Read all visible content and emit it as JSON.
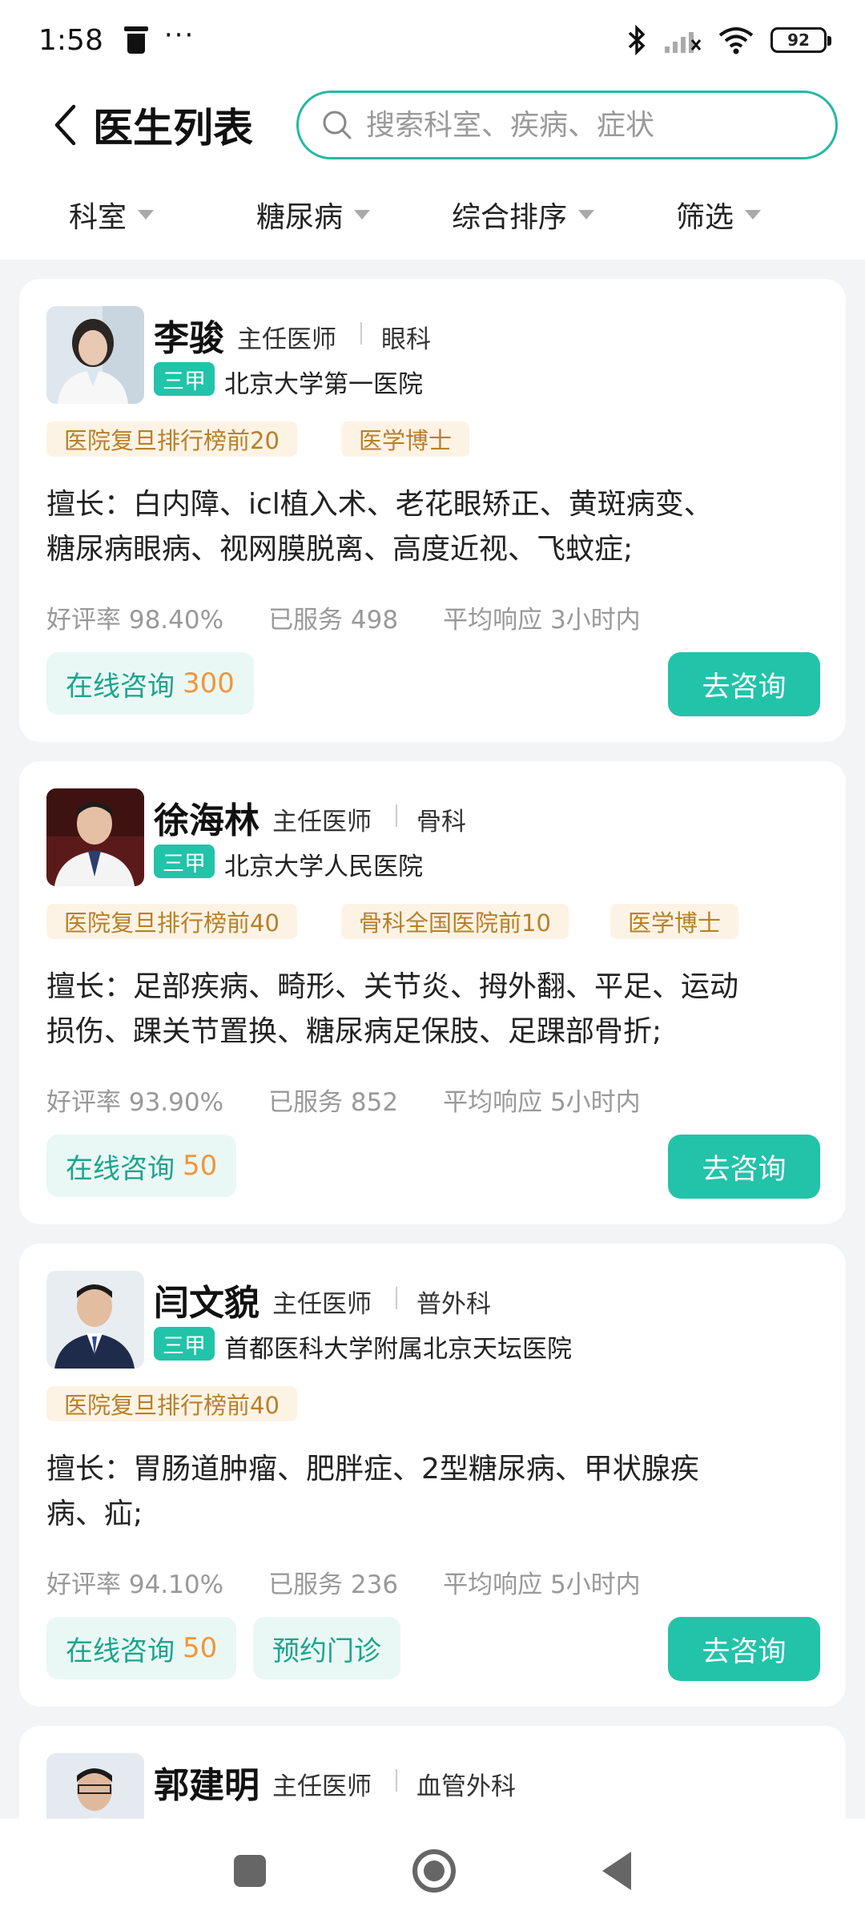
{
  "status_bar": {
    "time": "1:58",
    "battery": "92"
  },
  "header": {
    "title": "医生列表",
    "search_placeholder": "搜索科室、疾病、症状"
  },
  "filters": [
    "科室",
    "糖尿病",
    "综合排序",
    "筛选"
  ],
  "doctors": [
    {
      "name": "李骏",
      "title": "主任医师",
      "department": "眼科",
      "grade": "三甲",
      "hospital": "北京大学第一医院",
      "tags": [
        "医院复旦排行榜前20",
        "医学博士"
      ],
      "specialty_line1": "擅长：白内障、icl植入术、老花眼矫正、黄斑病变、",
      "specialty_line2": "糖尿病眼病、视网膜脱离、高度近视、飞蚊症;",
      "rating": "好评率 98.40%",
      "served": "已服务 498",
      "response": "平均响应 3小时内",
      "consult_label": "在线咨询",
      "consult_price": "300",
      "action": "去咨询"
    },
    {
      "name": "徐海林",
      "title": "主任医师",
      "department": "骨科",
      "grade": "三甲",
      "hospital": "北京大学人民医院",
      "tags": [
        "医院复旦排行榜前40",
        "骨科全国医院前10",
        "医学博士"
      ],
      "specialty_line1": "擅长：足部疾病、畸形、关节炎、拇外翻、平足、运动",
      "specialty_line2": "损伤、踝关节置换、糖尿病足保肢、足踝部骨折;",
      "rating": "好评率 93.90%",
      "served": "已服务 852",
      "response": "平均响应 5小时内",
      "consult_label": "在线咨询",
      "consult_price": "50",
      "action": "去咨询"
    },
    {
      "name": "闫文貌",
      "title": "主任医师",
      "department": "普外科",
      "grade": "三甲",
      "hospital": "首都医科大学附属北京天坛医院",
      "tags": [
        "医院复旦排行榜前40"
      ],
      "specialty_line1": "擅长：胃肠道肿瘤、肥胖症、2型糖尿病、甲状腺疾",
      "specialty_line2": "病、疝;",
      "rating": "好评率 94.10%",
      "served": "已服务 236",
      "response": "平均响应 5小时内",
      "consult_label": "在线咨询",
      "consult_price": "50",
      "appointment_label": "预约门诊",
      "action": "去咨询"
    },
    {
      "name": "郭建明",
      "title": "主任医师",
      "department": "血管外科"
    }
  ],
  "colors": {
    "accent": "#22c3a9",
    "tag_bg": "#fdf3e5",
    "tag_text": "#b6802b",
    "price": "#f2953b"
  }
}
